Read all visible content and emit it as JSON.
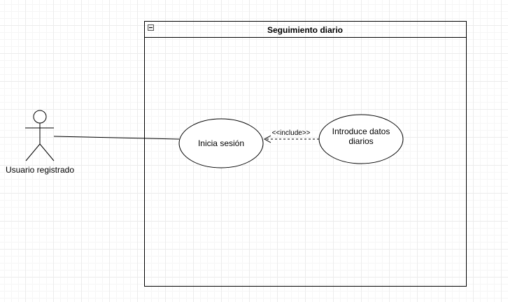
{
  "system": {
    "title": "Seguimiento diario"
  },
  "actor": {
    "label": "Usuario registrado"
  },
  "use_cases": [
    {
      "label_lines": [
        "Inicia sesión"
      ]
    },
    {
      "label_lines": [
        "Introduce datos",
        "diarios"
      ]
    }
  ],
  "relationships": {
    "include_label": "<<include>>"
  }
}
